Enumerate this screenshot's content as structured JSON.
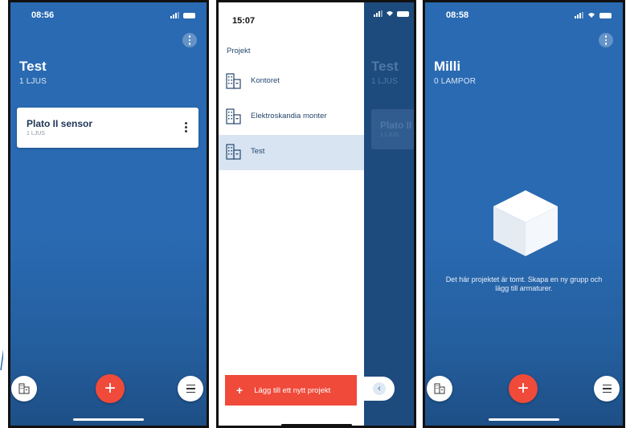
{
  "colors": {
    "primary_blue": "#2a6ab2",
    "accent_red": "#f04a3a",
    "drawer_selected": "#d8e4f2",
    "text_navy": "#27476d"
  },
  "screen1": {
    "time": "08:56",
    "project_title": "Test",
    "project_subtitle": "1 LJUS",
    "card": {
      "title": "Plato II sensor",
      "subtitle": "1 LJUS"
    },
    "fab_label": "+",
    "icons": [
      "building-icon",
      "plus-icon",
      "menu-icon",
      "more-icon"
    ]
  },
  "screen2": {
    "time": "15:07",
    "drawer_header": "Projekt",
    "items": [
      {
        "label": "Kontoret",
        "selected": false
      },
      {
        "label": "Elektroskandia monter",
        "selected": false
      },
      {
        "label": "Test",
        "selected": true
      }
    ],
    "new_project_label": "Lägg till ett nytt projekt",
    "new_project_plus": "+",
    "behind": {
      "title": "Test",
      "subtitle": "1 LJUS",
      "card_title": "Plato II",
      "card_subtitle": "1 LJUS"
    },
    "collapse_glyph": "‹"
  },
  "screen3": {
    "time": "08:58",
    "project_title": "Milli",
    "project_subtitle": "0 LAMPOR",
    "empty_message": "Det här projektet är tomt. Skapa en ny grupp och lägg till armaturer.",
    "fab_label": "+"
  }
}
